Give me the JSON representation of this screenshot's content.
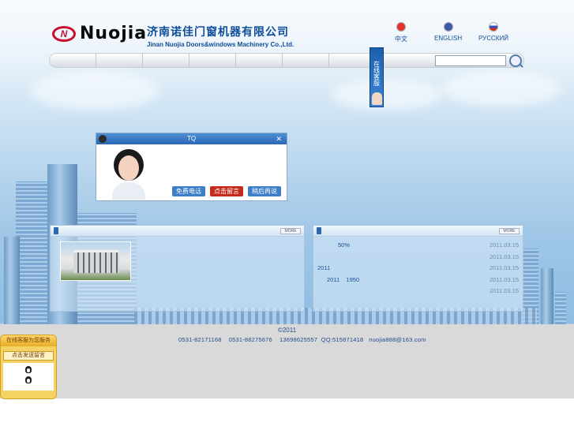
{
  "header": {
    "logo_text": "Nuojia",
    "logo_mark": "N",
    "company_cn": "济南诺佳门窗机器有限公司",
    "company_en": "Jinan Nuojia Doors&windows Machinery Co.,Ltd."
  },
  "languages": [
    {
      "label": "中文",
      "flag_color": "#e4322b"
    },
    {
      "label": "ENGLISH",
      "flag_color": "#3d5aa8"
    },
    {
      "label": "РУССКИЙ",
      "flag_color": "#d52b1e"
    }
  ],
  "search": {
    "placeholder": "",
    "button_icon": "search-icon"
  },
  "service_tab": {
    "label": "在线客服"
  },
  "qq_popup": {
    "title": "TQ",
    "buttons": [
      {
        "label": "免费电话",
        "color": "#3c7fc8"
      },
      {
        "label": "点击留言",
        "color": "#c52b1d"
      },
      {
        "label": "稍后再说",
        "color": "#3c7fc8"
      }
    ]
  },
  "panels": {
    "left": {
      "more_label": "MORE"
    },
    "right": {
      "more_label": "MORE",
      "news": [
        {
          "title": "50%",
          "date": "2011.03.15"
        },
        {
          "title": "",
          "date": "2011.03.15"
        },
        {
          "title": "2011",
          "date": "2011.03.15"
        },
        {
          "title": "2011    1950",
          "date": "2011.03.15"
        },
        {
          "title": "",
          "date": "2011.03.15"
        }
      ]
    }
  },
  "footer": {
    "copyright": "©2011",
    "contact": "0531-82171168    0531-88275676    13698625557  QQ:515871418   nuojia888@163.com"
  },
  "side_widget": {
    "title": "在线客服为您服务",
    "message_button": "点击发送留言"
  }
}
